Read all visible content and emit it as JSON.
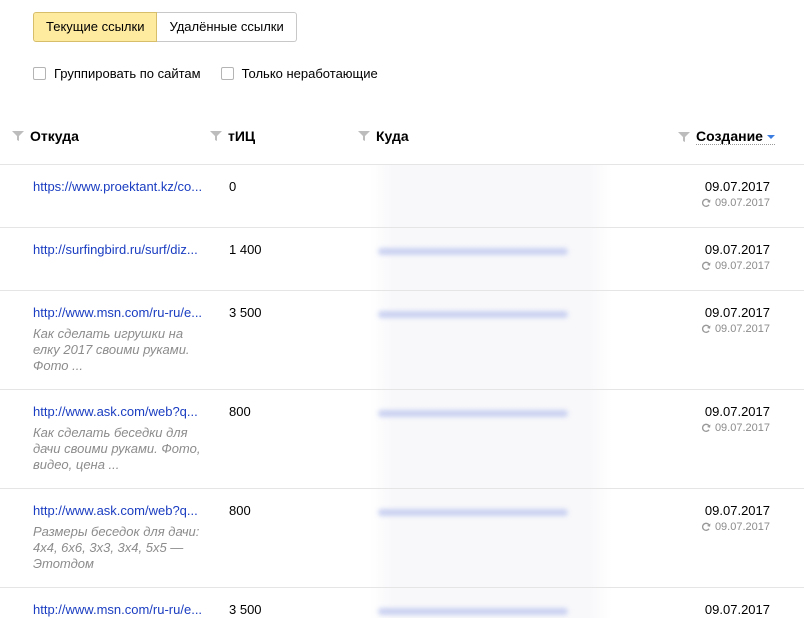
{
  "tabs": {
    "current": "Текущие ссылки",
    "deleted": "Удалённые ссылки"
  },
  "filters": {
    "group_by_site": "Группировать по сайтам",
    "only_broken": "Только неработающие"
  },
  "table": {
    "headers": {
      "from": "Откуда",
      "tic": "тИЦ",
      "to": "Куда",
      "created": "Создание"
    },
    "rows": [
      {
        "url": "https://www.proektant.kz/co...",
        "snippet": "",
        "tic": "0",
        "date": "09.07.2017",
        "check_date": "09.07.2017"
      },
      {
        "url": "http://surfingbird.ru/surf/diz...",
        "snippet": "",
        "tic": "1 400",
        "date": "09.07.2017",
        "check_date": "09.07.2017"
      },
      {
        "url": "http://www.msn.com/ru-ru/e...",
        "snippet": "Как сделать игрушки на елку 2017 своими руками. Фото ...",
        "tic": "3 500",
        "date": "09.07.2017",
        "check_date": "09.07.2017"
      },
      {
        "url": "http://www.ask.com/web?q...",
        "snippet": "Как сделать беседки для дачи своими руками. Фото, видео, цена ...",
        "tic": "800",
        "date": "09.07.2017",
        "check_date": "09.07.2017"
      },
      {
        "url": "http://www.ask.com/web?q...",
        "snippet": "Размеры беседок для дачи: 4x4, 6x6, 3x3, 3x4, 5x5 — Этотдом",
        "tic": "800",
        "date": "09.07.2017",
        "check_date": "09.07.2017"
      },
      {
        "url": "http://www.msn.com/ru-ru/e...",
        "snippet": "",
        "tic": "3 500",
        "date": "09.07.2017",
        "check_date": ""
      }
    ]
  },
  "colors": {
    "active_tab": "#ffeba0",
    "link": "#1a3dc1",
    "sort_arrow": "#3a7ce0"
  }
}
